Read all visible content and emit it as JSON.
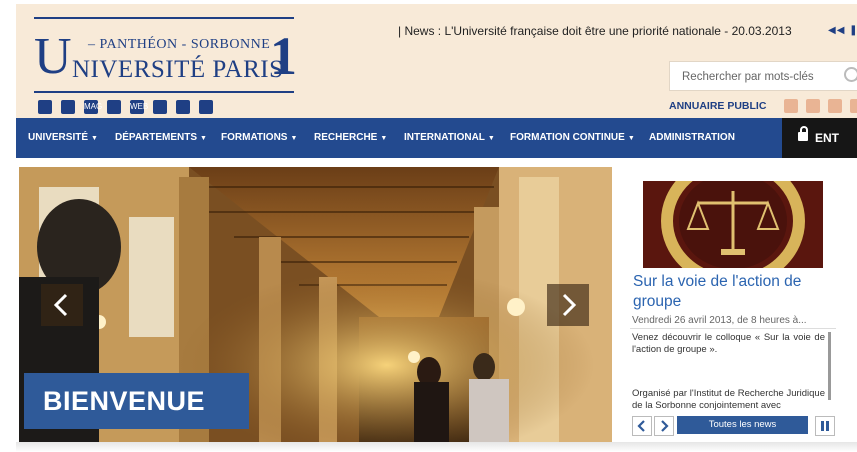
{
  "logo": {
    "line1": "– PANTHÉON - SORBONNE –",
    "big_u": "U",
    "line2": "NIVERSITÉ PARIS",
    "number": "1"
  },
  "news_ticker": {
    "text": "| News : L'Université française doit être une priorité nationale - 20.03.2013",
    "controls": "◀◀ ❚❚ ▶▶"
  },
  "search": {
    "placeholder": "Rechercher par mots-clés"
  },
  "annuaire": "ANNUAIRE PUBLIC",
  "toolbar_icons": [
    "photo-icon",
    "people-icon",
    "mag-icon",
    "printer-icon",
    "web-icon",
    "book-icon",
    "calendar-icon",
    "pen-icon"
  ],
  "toolbar_icon_labels": [
    "",
    "",
    "MAG",
    "",
    "WEB",
    "",
    "",
    ""
  ],
  "social_icons": [
    "rss-icon",
    "itunes-icon",
    "twitter-icon",
    "facebook-icon"
  ],
  "nav": {
    "items": [
      {
        "label": "UNIVERSITÉ",
        "caret": "▼"
      },
      {
        "label": "DÉPARTEMENTS",
        "caret": "▼"
      },
      {
        "label": "FORMATIONS",
        "caret": "▼"
      },
      {
        "label": "RECHERCHE",
        "caret": "▼"
      },
      {
        "label": "INTERNATIONAL",
        "caret": "▼"
      },
      {
        "label": "FORMATION CONTINUE",
        "caret": "▼"
      },
      {
        "label": "ADMINISTRATION",
        "caret": ""
      }
    ],
    "ent_label": "ENT"
  },
  "hero": {
    "caption": "BIENVENUE"
  },
  "news_card": {
    "title": "Sur la voie de l'action de groupe",
    "date": "Vendredi 26 avril 2013, de 8 heures à...",
    "paragraph1": "Venez découvrir le colloque « Sur la voie de l'action de groupe ».",
    "paragraph2": "Organisé par l'Institut de Recherche Juridique de la Sorbonne conjointement avec",
    "all_news": "Toutes les news"
  },
  "colors": {
    "brand_blue": "#1f3f84",
    "nav_blue": "#234a8f",
    "header_bg": "#f8ead8",
    "link_blue": "#2b64b0"
  }
}
